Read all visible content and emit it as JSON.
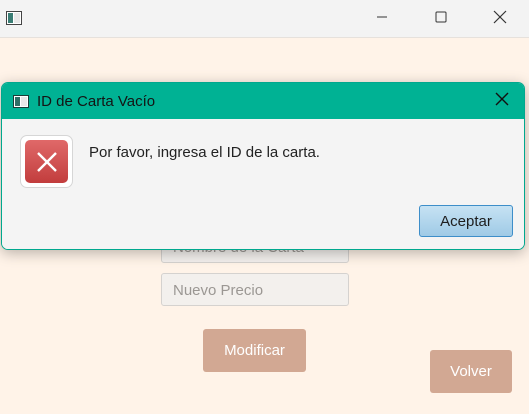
{
  "main_window": {
    "app_icon": "window-icon",
    "controls": {
      "minimize": "minimize-icon",
      "maximize": "maximize-icon",
      "close": "close-icon"
    },
    "form": {
      "name_placeholder": "Nombre de la Carta",
      "price_placeholder": "Nuevo Precio",
      "modify_label": "Modificar",
      "back_label": "Volver"
    }
  },
  "dialog": {
    "title": "ID de Carta Vacío",
    "message": "Por favor, ingresa el ID de la carta.",
    "accept_label": "Aceptar",
    "icon": "error-icon"
  },
  "colors": {
    "dialog_accent": "#00b294",
    "button_brown": "#d2a893",
    "error_red": "#c94444",
    "background": "#fff3e8"
  }
}
